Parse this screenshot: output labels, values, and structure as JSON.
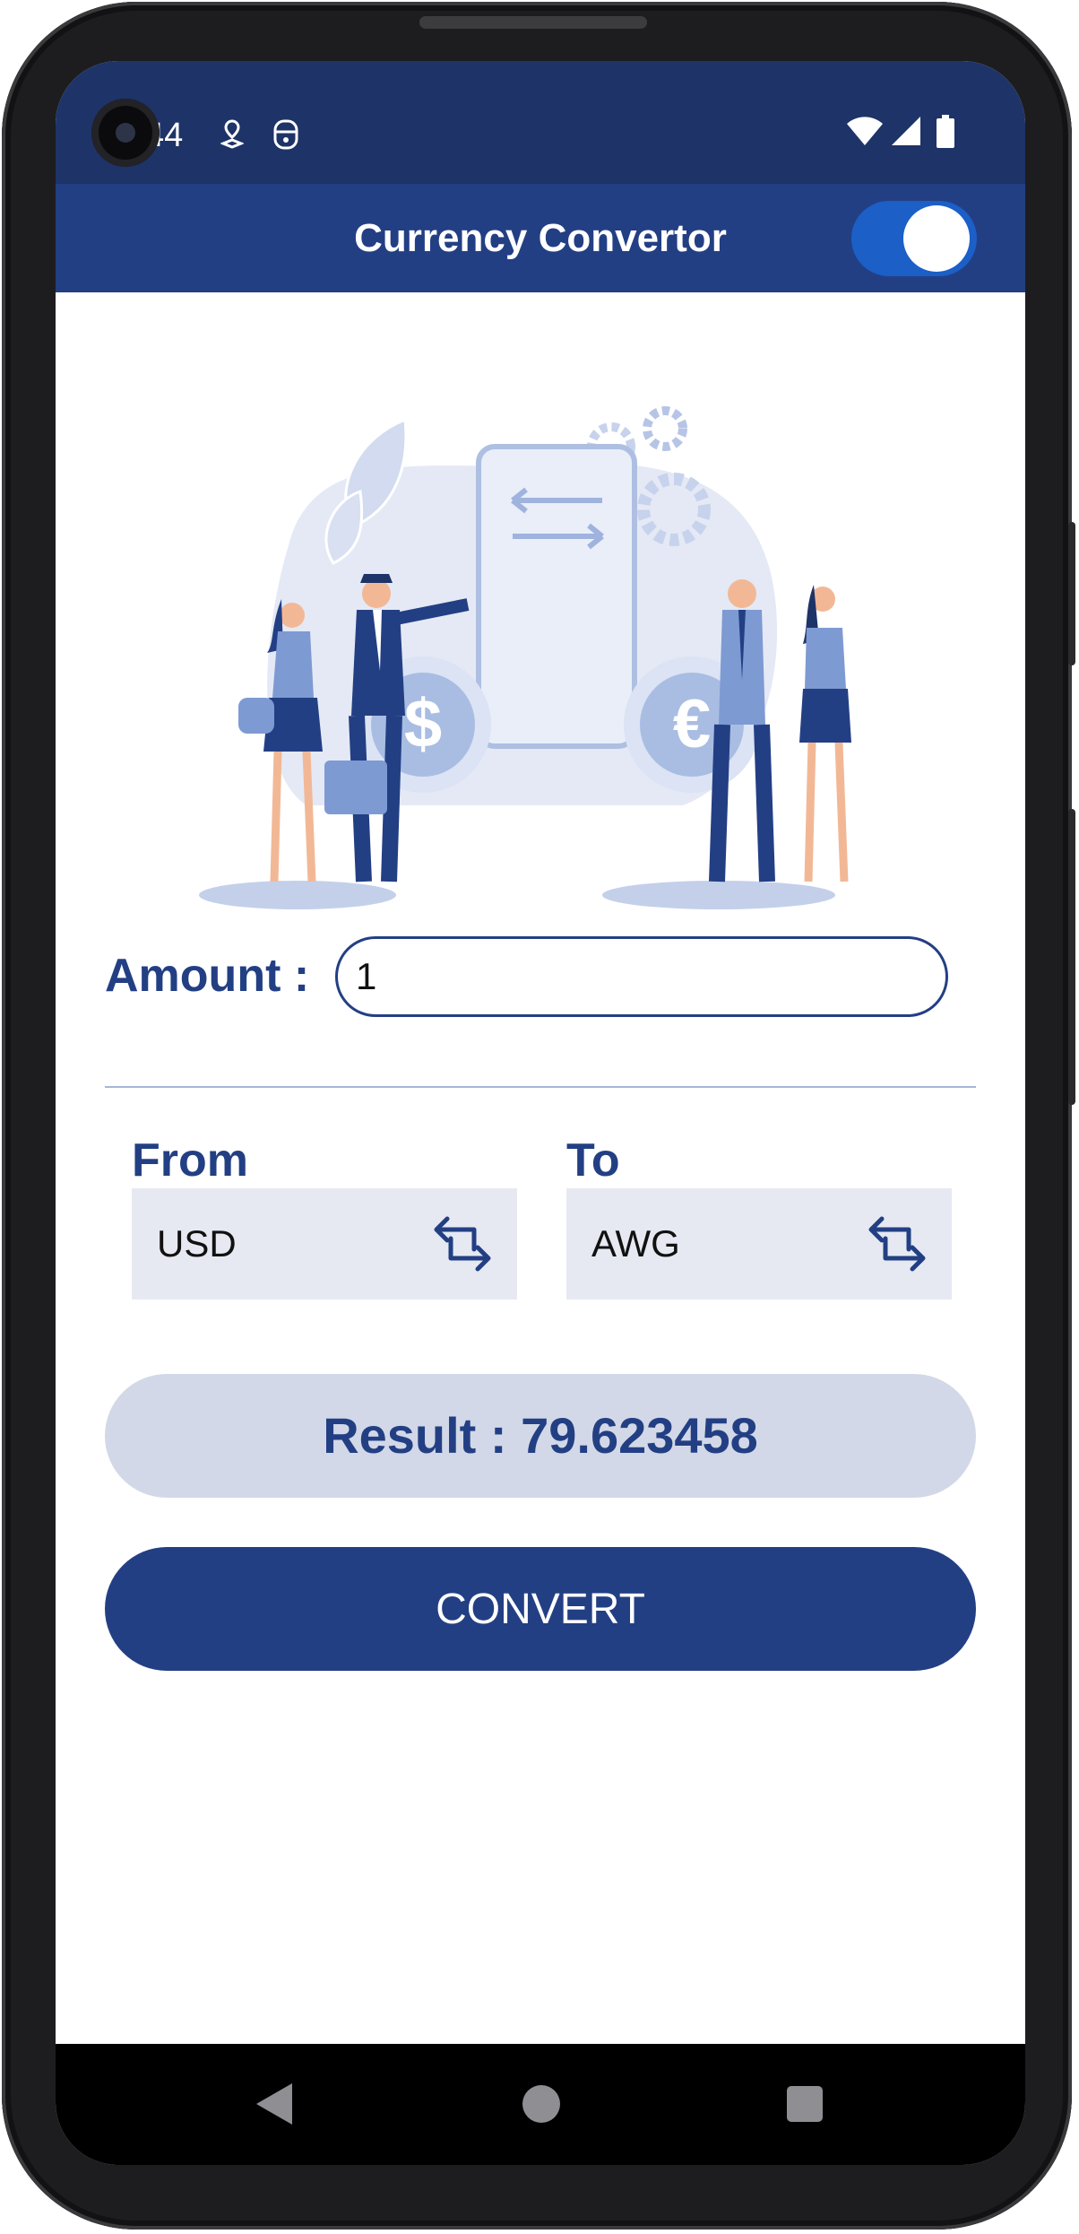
{
  "status_bar": {
    "time": "44"
  },
  "app_bar": {
    "title": "Currency Convertor",
    "toggle_on": true
  },
  "amount": {
    "label": "Amount  :",
    "value": "1"
  },
  "from": {
    "label": "From",
    "selected": "USD"
  },
  "to": {
    "label": "To",
    "selected": "AWG"
  },
  "result": {
    "text": "Result  :  79.623458"
  },
  "convert_button": {
    "label": "CONVERT"
  },
  "icons": {
    "status": [
      "camera-icon",
      "location-icon",
      "privacy-icon",
      "wifi-icon",
      "signal-icon",
      "battery-icon"
    ],
    "spinner": "swap-icon",
    "nav": [
      "back-icon",
      "home-icon",
      "recents-icon"
    ]
  },
  "colors": {
    "primary": "#233f84",
    "status_bar": "#1e3368",
    "toggle": "#1b5fc7",
    "result_bg": "#d2d8e7",
    "spinner_bg": "#e6e9f2"
  }
}
